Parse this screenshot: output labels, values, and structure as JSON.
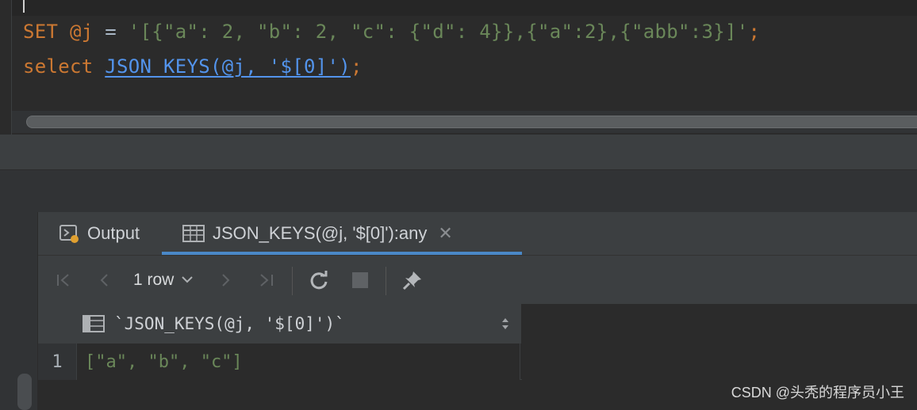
{
  "editor": {
    "line1": {
      "kw": "SET",
      "var": "@j",
      "op": " = ",
      "str": "'[{\"a\": 2, \"b\": 2, \"c\": {\"d\": 4}},{\"a\":2},{\"abb\":3}]'",
      "semi": ";"
    },
    "line2": {
      "kw": "select",
      "fn": "JSON_KEYS(@j, '$[0]')",
      "semi": ";"
    }
  },
  "tabs": {
    "output_label": "Output",
    "result_label": "JSON_KEYS(@j, '$[0]'):any",
    "close_glyph": "✕"
  },
  "toolbar": {
    "first": "|‹",
    "prev": "‹",
    "rows_label": "1 row",
    "next": "›",
    "last": "›|",
    "refresh_icon": "refresh-icon",
    "stop_icon": "stop-icon",
    "pin_icon": "pin-icon"
  },
  "grid": {
    "column_title": "`JSON_KEYS(@j, '$[0]')`",
    "rows": [
      {
        "num": "1",
        "value": "[\"a\", \"b\", \"c\"]"
      }
    ]
  },
  "watermark": "CSDN @头秃的程序员小王",
  "colors": {
    "accent": "#4a88c7",
    "keyword": "#cc7832",
    "string": "#6a8759",
    "function": "#5394ec"
  }
}
